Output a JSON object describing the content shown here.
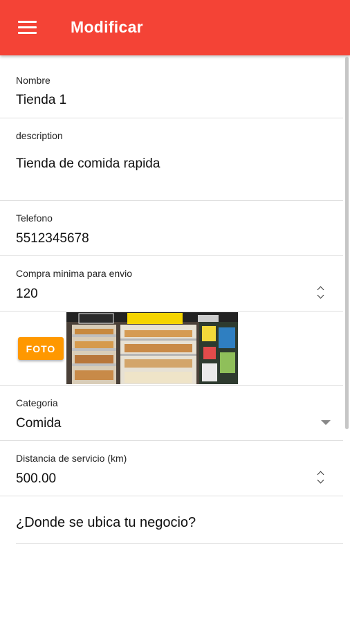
{
  "appbar": {
    "title": "Modificar",
    "menu_icon": "menu-icon",
    "color": "#f44336"
  },
  "form": {
    "nombre": {
      "label": "Nombre",
      "value": "Tienda 1"
    },
    "description": {
      "label": "description",
      "value": "Tienda de comida rapida"
    },
    "telefono": {
      "label": "Telefono",
      "value": "5512345678"
    },
    "compra_minima": {
      "label": "Compra minima para envio",
      "value": "120"
    },
    "foto": {
      "button_label": "FOTO",
      "button_color": "#ff9800"
    },
    "categoria": {
      "label": "Categoria",
      "value": "Comida"
    },
    "distancia": {
      "label": "Distancia de servicio (km)",
      "value": "500.00"
    },
    "ubicacion": {
      "prompt": "¿Donde se ubica tu negocio?"
    }
  }
}
